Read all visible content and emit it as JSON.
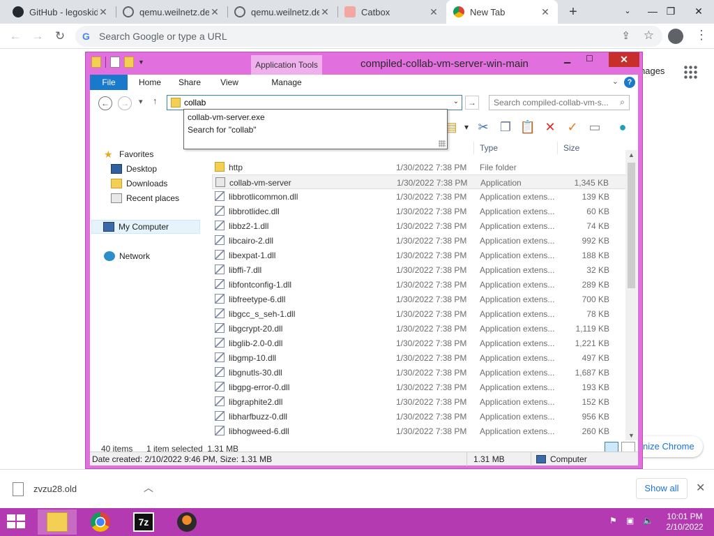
{
  "browser": {
    "tabs": [
      {
        "title": "GitHub - legoskid",
        "icon": "github-icon",
        "active": false
      },
      {
        "title": "qemu.weilnetz.de",
        "icon": "globe-icon",
        "active": false
      },
      {
        "title": "qemu.weilnetz.de",
        "icon": "globe-icon",
        "active": false
      },
      {
        "title": "Catbox",
        "icon": "cat-icon",
        "active": false
      },
      {
        "title": "New Tab",
        "icon": "chrome-icon",
        "active": true
      }
    ],
    "new_tab_label": "+",
    "omnibox_placeholder": "Search Google or type a URL",
    "images_link": "nages",
    "customize_label": "nize Chrome"
  },
  "downloads": {
    "file_name": "zvzu28.old",
    "show_all": "Show all"
  },
  "explorer": {
    "title": "compiled-collab-vm-server-win-main",
    "context_tab": "Application Tools",
    "ribbon_tabs": [
      "File",
      "Home",
      "Share",
      "View",
      "Manage"
    ],
    "address_value": "collab",
    "search_placeholder": "Search compiled-collab-vm-s...",
    "autocomplete": [
      "collab-vm-server.exe",
      "Search for \"collab\""
    ],
    "columns": {
      "type": "Type",
      "size": "Size"
    },
    "nav": {
      "favorites": "Favorites",
      "desktop": "Desktop",
      "downloads": "Downloads",
      "recent": "Recent places",
      "my_computer": "My Computer",
      "network": "Network"
    },
    "files": [
      {
        "name": "http",
        "date": "1/30/2022 7:38 PM",
        "type": "File folder",
        "size": "",
        "kind": "folder"
      },
      {
        "name": "collab-vm-server",
        "date": "1/30/2022 7:38 PM",
        "type": "Application",
        "size": "1,345 KB",
        "kind": "exe"
      },
      {
        "name": "libbrotlicommon.dll",
        "date": "1/30/2022 7:38 PM",
        "type": "Application extens...",
        "size": "139 KB",
        "kind": "dll"
      },
      {
        "name": "libbrotlidec.dll",
        "date": "1/30/2022 7:38 PM",
        "type": "Application extens...",
        "size": "60 KB",
        "kind": "dll"
      },
      {
        "name": "libbz2-1.dll",
        "date": "1/30/2022 7:38 PM",
        "type": "Application extens...",
        "size": "74 KB",
        "kind": "dll"
      },
      {
        "name": "libcairo-2.dll",
        "date": "1/30/2022 7:38 PM",
        "type": "Application extens...",
        "size": "992 KB",
        "kind": "dll"
      },
      {
        "name": "libexpat-1.dll",
        "date": "1/30/2022 7:38 PM",
        "type": "Application extens...",
        "size": "188 KB",
        "kind": "dll"
      },
      {
        "name": "libffi-7.dll",
        "date": "1/30/2022 7:38 PM",
        "type": "Application extens...",
        "size": "32 KB",
        "kind": "dll"
      },
      {
        "name": "libfontconfig-1.dll",
        "date": "1/30/2022 7:38 PM",
        "type": "Application extens...",
        "size": "289 KB",
        "kind": "dll"
      },
      {
        "name": "libfreetype-6.dll",
        "date": "1/30/2022 7:38 PM",
        "type": "Application extens...",
        "size": "700 KB",
        "kind": "dll"
      },
      {
        "name": "libgcc_s_seh-1.dll",
        "date": "1/30/2022 7:38 PM",
        "type": "Application extens...",
        "size": "78 KB",
        "kind": "dll"
      },
      {
        "name": "libgcrypt-20.dll",
        "date": "1/30/2022 7:38 PM",
        "type": "Application extens...",
        "size": "1,119 KB",
        "kind": "dll"
      },
      {
        "name": "libglib-2.0-0.dll",
        "date": "1/30/2022 7:38 PM",
        "type": "Application extens...",
        "size": "1,221 KB",
        "kind": "dll"
      },
      {
        "name": "libgmp-10.dll",
        "date": "1/30/2022 7:38 PM",
        "type": "Application extens...",
        "size": "497 KB",
        "kind": "dll"
      },
      {
        "name": "libgnutls-30.dll",
        "date": "1/30/2022 7:38 PM",
        "type": "Application extens...",
        "size": "1,687 KB",
        "kind": "dll"
      },
      {
        "name": "libgpg-error-0.dll",
        "date": "1/30/2022 7:38 PM",
        "type": "Application extens...",
        "size": "193 KB",
        "kind": "dll"
      },
      {
        "name": "libgraphite2.dll",
        "date": "1/30/2022 7:38 PM",
        "type": "Application extens...",
        "size": "152 KB",
        "kind": "dll"
      },
      {
        "name": "libharfbuzz-0.dll",
        "date": "1/30/2022 7:38 PM",
        "type": "Application extens...",
        "size": "956 KB",
        "kind": "dll"
      },
      {
        "name": "libhogweed-6.dll",
        "date": "1/30/2022 7:38 PM",
        "type": "Application extens...",
        "size": "260 KB",
        "kind": "dll"
      }
    ],
    "selected_index": 1,
    "status": {
      "item_count": "40 items",
      "selection": "1 item selected  1.31 MB",
      "details": "Date created: 2/10/2022 9:46 PM, Size: 1.31 MB",
      "size": "1.31 MB",
      "location": "Computer"
    }
  },
  "taskbar": {
    "time": "10:01 PM",
    "date": "2/10/2022",
    "sevenzip_label": "7z"
  },
  "colors": {
    "window_frame": "#e26fde",
    "taskbar": "#b43ab1",
    "file_tab": "#1979ca",
    "close_button": "#c7302a"
  }
}
